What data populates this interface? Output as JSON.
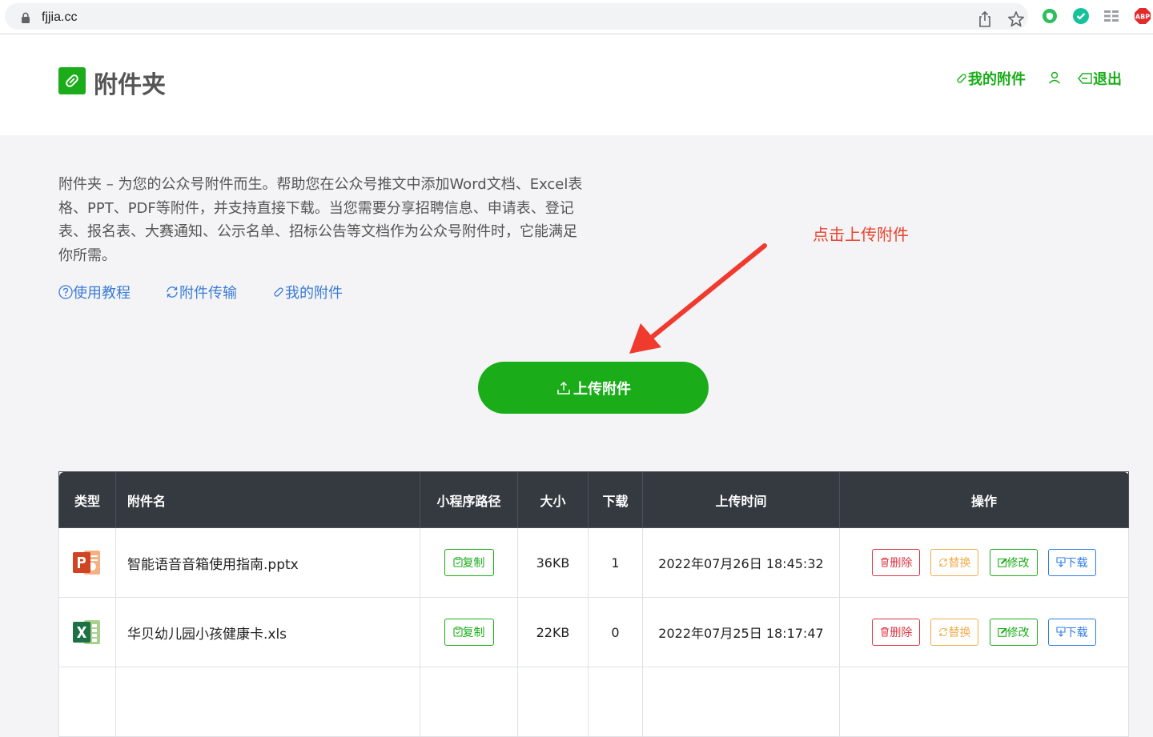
{
  "browser": {
    "url": "fjjia.cc",
    "ext_abp": "ABP"
  },
  "header": {
    "site_title": "附件夹",
    "nav_my_attachments": "我的附件",
    "nav_logout": "退出"
  },
  "intro": {
    "text": "附件夹 – 为您的公众号附件而生。帮助您在公众号推文中添加Word文档、Excel表格、PPT、PDF等附件，并支持直接下载。当您需要分享招聘信息、申请表、登记表、报名表、大赛通知、公示名单、招标公告等文档作为公众号附件时，它能满足你所需。",
    "links": {
      "tutorial": "使用教程",
      "transfer": "附件传输",
      "mine": "我的附件"
    }
  },
  "annotation": "点击上传附件",
  "upload_button": "上传附件",
  "table": {
    "headers": {
      "type": "类型",
      "name": "附件名",
      "path": "小程序路径",
      "size": "大小",
      "downloads": "下载",
      "time": "上传时间",
      "ops": "操作"
    },
    "rows": [
      {
        "type_icon": "powerpoint-icon",
        "name": "智能语音音箱使用指南.pptx",
        "copy": "复制",
        "size": "36KB",
        "downloads": "1",
        "time": "2022年07月26日 18:45:32",
        "delete": "删除",
        "replace": "替换",
        "edit": "修改",
        "download": "下载"
      },
      {
        "type_icon": "excel-icon",
        "name": "华贝幼儿园小孩健康卡.xls",
        "copy": "复制",
        "size": "22KB",
        "downloads": "0",
        "time": "2022年07月25日 18:17:47",
        "delete": "删除",
        "replace": "替换",
        "edit": "修改",
        "download": "下载"
      }
    ]
  },
  "colors": {
    "brand_green": "#1aad19",
    "link_blue": "#3a7bd5",
    "annotation_red": "#e8432d",
    "table_header": "#343a40"
  }
}
